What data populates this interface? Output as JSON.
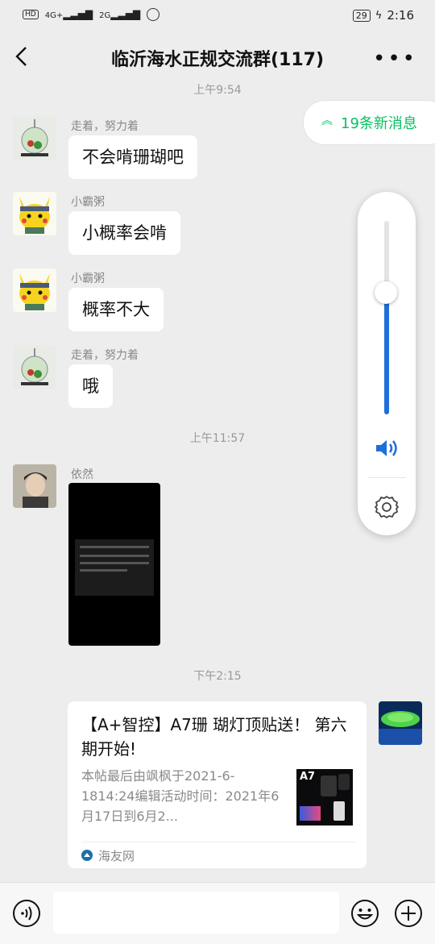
{
  "status_bar": {
    "left_indicators": [
      "HD",
      "4G+",
      "2G"
    ],
    "battery": "29",
    "time": "2:16"
  },
  "header": {
    "title": "临沂海水正规交流群(117)"
  },
  "new_messages": {
    "label": "19条新消息"
  },
  "timestamps": [
    "上午9:54",
    "上午11:57",
    "下午2:15"
  ],
  "messages": [
    {
      "sender": "走着，努力着",
      "text": "不会啃珊瑚吧"
    },
    {
      "sender": "小霸粥",
      "text": "小概率会啃"
    },
    {
      "sender": "小霸粥",
      "text": "概率不大"
    },
    {
      "sender": "走着，努力着",
      "text": "哦"
    },
    {
      "sender": "依然",
      "type": "image"
    }
  ],
  "volume": {
    "level": 0.63
  },
  "card": {
    "title": "【A+智控】A7珊 瑚灯顶贴送！ 第六期开始!",
    "description": "本帖最后由飒枫于2021-6-1814:24编辑活动时间：2021年6月17日到6月2...",
    "thumbnail_label": "A7",
    "source": "海友网"
  },
  "colors": {
    "accent": "#07c160",
    "volume": "#1e6fd9"
  }
}
